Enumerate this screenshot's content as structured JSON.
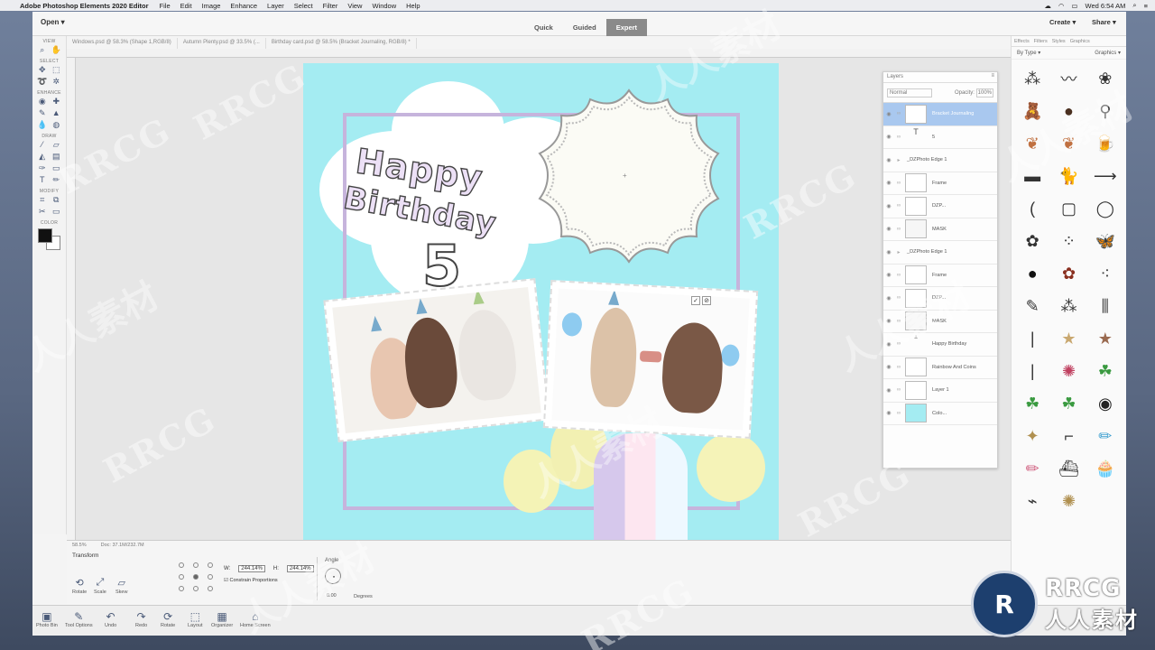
{
  "menubar": {
    "apple": "",
    "app_name": "Adobe Photoshop Elements 2020 Editor",
    "items": [
      "File",
      "Edit",
      "Image",
      "Enhance",
      "Layer",
      "Select",
      "Filter",
      "View",
      "Window",
      "Help"
    ],
    "clock": "Wed 6:54 AM"
  },
  "toolbar": {
    "open_label": "Open",
    "modes": [
      "Quick",
      "Guided",
      "Expert"
    ],
    "active_mode": "Expert",
    "create_label": "Create",
    "share_label": "Share"
  },
  "doc_tabs": [
    "Windows.psd @ 58.3% (Shape 1,RGB/8)",
    "Autumn Plenty.psd @ 33.5% (...",
    "Birthday card.psd @ 58.5% (Bracket Journaling, RGB/8) *"
  ],
  "tool_sections": {
    "view": "VIEW",
    "select": "SELECT",
    "enhance": "ENHANCE",
    "draw": "DRAW",
    "modify": "MODIFY",
    "color": "COLOR"
  },
  "card": {
    "title_line1": "Happy",
    "title_line2": "Birthday",
    "number": "5"
  },
  "layers_panel": {
    "title": "Layers",
    "blend_mode": "Normal",
    "opacity_label": "Opacity:",
    "opacity_value": "100%",
    "rows": [
      {
        "name": "Bracket Journaling",
        "selected": true
      },
      {
        "name": "5"
      },
      {
        "name": "_DZPhoto Edge 1"
      },
      {
        "name": "Frame"
      },
      {
        "name": "DZP..."
      },
      {
        "name": "MASK"
      },
      {
        "name": "_DZPhoto Edge 1"
      },
      {
        "name": "Frame"
      },
      {
        "name": "DZP..."
      },
      {
        "name": "MASK"
      },
      {
        "name": "Happy Birthday"
      },
      {
        "name": "Rainbow And Coins"
      },
      {
        "name": "Layer 1"
      },
      {
        "name": "Colo..."
      }
    ]
  },
  "right_panel": {
    "tabs": [
      "Effects",
      "Filters",
      "Styles",
      "Graphics"
    ],
    "filter_by": "By Type",
    "category": "Graphics"
  },
  "tool_options": {
    "status_zoom": "58.5%",
    "status_doc": "Doc: 37.1M/232.7M",
    "tool_name": "Transform",
    "buttons": [
      "Rotate",
      "Scale",
      "Skew"
    ],
    "w_label": "W:",
    "w_value": "244.14%",
    "h_label": "H:",
    "h_value": "244.14%",
    "constrain_label": "Constrain Proportions",
    "angle_label": "Angle",
    "angle_value": "0.00",
    "degrees_label": "Degrees"
  },
  "bottom_bar": {
    "buttons": [
      "Photo Bin",
      "Tool Options",
      "Undo",
      "Redo",
      "Rotate",
      "Layout",
      "Organizer",
      "Home Screen"
    ],
    "more": "More"
  },
  "watermark": {
    "latin": "RRCG",
    "cjk": "人人素材"
  },
  "colors": {
    "canvas_bg": "#a4ecf2",
    "frame": "#c6b4dc",
    "selected_layer": "#a9c8ef",
    "logo_badge": "#1d3f6e"
  }
}
